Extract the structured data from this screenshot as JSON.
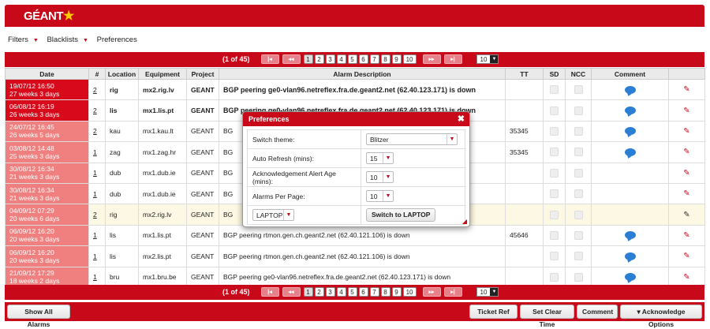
{
  "brand": {
    "name": "GÉANT",
    "star": "★"
  },
  "menu": {
    "filters": "Filters",
    "blacklists": "Blacklists",
    "preferences": "Preferences"
  },
  "pager": {
    "count": "(1 of 45)",
    "first": "|◂",
    "prev": "◂◂",
    "next": "▸▸",
    "last": "▸|",
    "pages": [
      "1",
      "2",
      "3",
      "4",
      "5",
      "6",
      "7",
      "8",
      "9",
      "10"
    ],
    "per_page": "10"
  },
  "grid": {
    "headers": [
      "Date",
      "#",
      "Location",
      "Equipment",
      "Project",
      "Alarm Description",
      "TT",
      "SD",
      "NCC",
      "Comment",
      ""
    ],
    "rows": [
      {
        "date1": "19/07/12 16:50",
        "date2": "27 weeks 3 days",
        "num": "2",
        "loc": "rig",
        "equip": "mx2.rig.lv",
        "proj": "GEANT",
        "desc": "BGP peering ge0-vlan96.netreflex.fra.de.geant2.net (62.40.123.171) is down",
        "tt": ""
      },
      {
        "date1": "06/08/12 16:19",
        "date2": "26 weeks 3 days",
        "num": "2",
        "loc": "lis",
        "equip": "mx1.lis.pt",
        "proj": "GEANT",
        "desc": "BGP peering ge0-vlan96.netreflex.fra.de.geant2.net (62.40.123.171) is down",
        "tt": ""
      },
      {
        "date1": "24/07/12 16:45",
        "date2": "26 weeks 5 days",
        "num": "2",
        "loc": "kau",
        "equip": "mx1.kau.lt",
        "proj": "GEANT",
        "desc": "BG",
        "tt": "35345"
      },
      {
        "date1": "03/08/12 14:48",
        "date2": "25 weeks 3 days",
        "num": "1",
        "loc": "zag",
        "equip": "mx1.zag.hr",
        "proj": "GEANT",
        "desc": "BG",
        "tt": "35345"
      },
      {
        "date1": "30/08/12 16:34",
        "date2": "21 weeks 3 days",
        "num": "1",
        "loc": "dub",
        "equip": "mx1.dub.ie",
        "proj": "GEANT",
        "desc": "BG",
        "tt": ""
      },
      {
        "date1": "30/08/12 16:34",
        "date2": "21 weeks 3 days",
        "num": "1",
        "loc": "dub",
        "equip": "mx1.dub.ie",
        "proj": "GEANT",
        "desc": "BG",
        "tt": ""
      },
      {
        "date1": "04/09/12 07:29",
        "date2": "20 weeks 6 days",
        "num": "2",
        "loc": "rig",
        "equip": "mx2.rig.lv",
        "proj": "GEANT",
        "desc": "BG",
        "tt": ""
      },
      {
        "date1": "06/09/12 16:20",
        "date2": "20 weeks 3 days",
        "num": "1",
        "loc": "lis",
        "equip": "mx1.lis.pt",
        "proj": "GEANT",
        "desc": "BGP peering rtmon.gen.ch.geant2.net (62.40.121.106) is down",
        "tt": "45646"
      },
      {
        "date1": "06/09/12 16:20",
        "date2": "20 weeks 3 days",
        "num": "1",
        "loc": "lis",
        "equip": "mx2.lis.pt",
        "proj": "GEANT",
        "desc": "BGP peering rtmon.gen.ch.geant2.net (62.40.121.106) is down",
        "tt": ""
      },
      {
        "date1": "21/09/12 17:29",
        "date2": "18 weeks 2 days",
        "num": "1",
        "loc": "bru",
        "equip": "mx1.bru.be",
        "proj": "GEANT",
        "desc": "BGP peering ge0-vlan96.netreflex.fra.de.geant2.net (62.40.123.171) is down",
        "tt": ""
      }
    ]
  },
  "toolbar": {
    "show_all": "Show All Alarms",
    "ticket_ref": "Ticket Ref",
    "set_clear": "Set Clear Time",
    "comment": "Comment",
    "ack": "▾ Acknowledge Options"
  },
  "dialog": {
    "title": "Preferences",
    "close": "✖",
    "theme_label": "Switch theme:",
    "theme_value": "Blitzer",
    "refresh_label": "Auto Refresh (mins):",
    "refresh_value": "15",
    "ack_age_label": "Acknowledgement Alert Age (mins):",
    "ack_age_value": "10",
    "alarms_label": "Alarms Per Page:",
    "alarms_value": "10",
    "device_value": "LAPTOP",
    "switch_button": "Switch to LAPTOP"
  },
  "colors": {
    "accent": "#c8091a",
    "row_date": "#f08080",
    "row_date_critical": "#d8091a"
  }
}
